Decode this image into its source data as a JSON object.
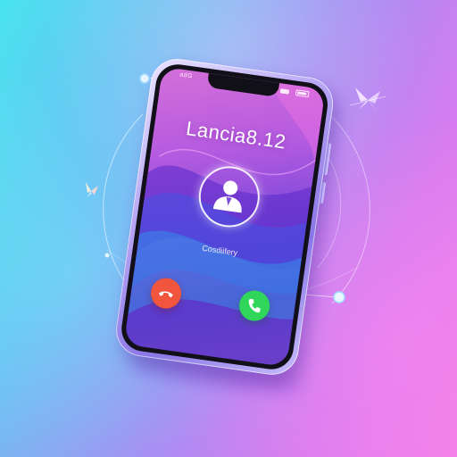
{
  "status_bar": {
    "carrier_text": "adG"
  },
  "call": {
    "caller_name": "Lancia8.12",
    "status_text": "Cosdiifery"
  },
  "controls": {
    "decline_icon": "phone-down-icon",
    "accept_icon": "phone-icon"
  },
  "colors": {
    "decline": "#f2553d",
    "accept": "#2fd65a",
    "screen_top": "#d46fd9",
    "screen_bottom": "#5a3bcb"
  }
}
